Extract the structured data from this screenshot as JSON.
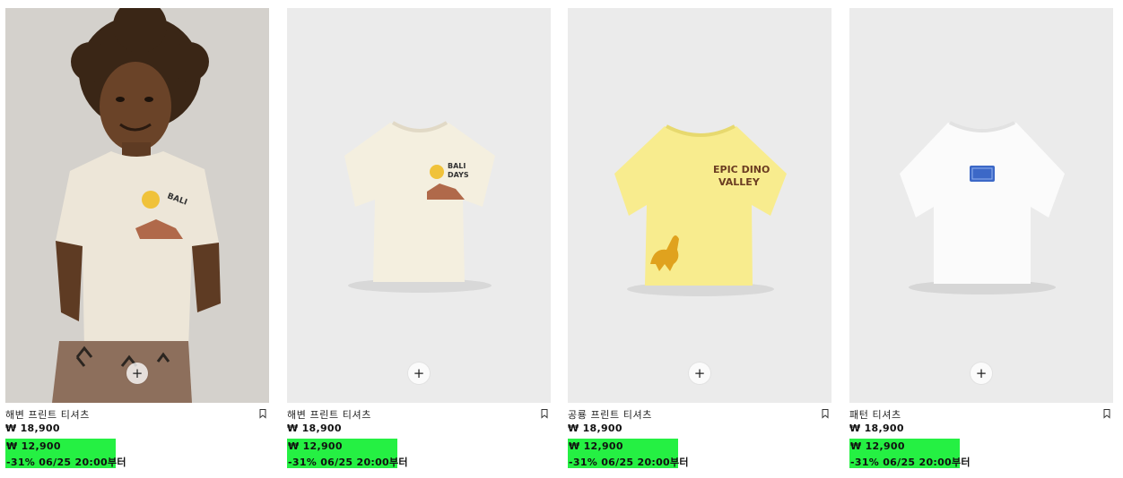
{
  "products": [
    {
      "name": "해변 프린트 티셔츠",
      "price": "₩ 18,900",
      "sale_price": "₩ 12,900",
      "sale_note": "-31% 06/25 20:00부터",
      "add_icon": "plus-icon",
      "bookmark_icon": "bookmark-icon"
    },
    {
      "name": "해변 프린트 티셔츠",
      "price": "₩ 18,900",
      "sale_price": "₩ 12,900",
      "sale_note": "-31% 06/25 20:00부터",
      "add_icon": "plus-icon",
      "bookmark_icon": "bookmark-icon"
    },
    {
      "name": "공룡 프린트 티셔츠",
      "price": "₩ 18,900",
      "sale_price": "₩ 12,900",
      "sale_note": "-31% 06/25 20:00부터",
      "add_icon": "plus-icon",
      "bookmark_icon": "bookmark-icon"
    },
    {
      "name": "패턴 티셔츠",
      "price": "₩ 18,900",
      "sale_price": "₩ 12,900",
      "sale_note": "-31% 06/25 20:00부터",
      "add_icon": "plus-icon",
      "bookmark_icon": "bookmark-icon"
    }
  ],
  "colors": {
    "sale_highlight": "#25f043",
    "tee_cream": "#f4efdf",
    "tee_yellow": "#f8ec8e",
    "tee_white": "#fbfbfb"
  },
  "tee_prints": {
    "bali": [
      "BALI",
      "DAYS"
    ],
    "dino": [
      "EPIC DINO",
      "VALLEY"
    ]
  }
}
